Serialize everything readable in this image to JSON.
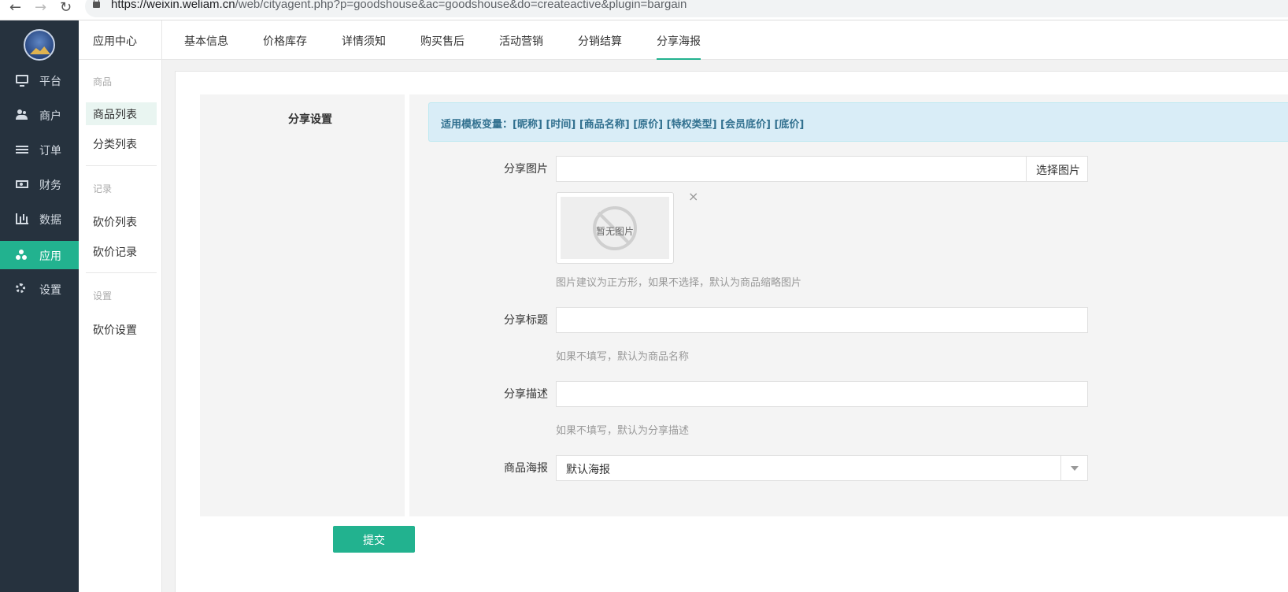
{
  "browser": {
    "url_host": "https://weixin.weliam.cn",
    "url_path": "/web/cityagent.php?p=goodshouse&ac=goodshouse&do=createactive&plugin=bargain"
  },
  "sidebar": {
    "items": [
      {
        "label": "平台",
        "icon": "monitor-icon"
      },
      {
        "label": "商户",
        "icon": "users-icon"
      },
      {
        "label": "订单",
        "icon": "list-icon"
      },
      {
        "label": "财务",
        "icon": "money-icon"
      },
      {
        "label": "数据",
        "icon": "bar-chart-icon"
      },
      {
        "label": "应用",
        "icon": "apps-icon",
        "active": true
      },
      {
        "label": "设置",
        "icon": "gear-icon"
      }
    ]
  },
  "sub_sidebar": {
    "header": "应用中心",
    "groups": [
      {
        "title": "商品",
        "items": [
          "商品列表",
          "分类列表"
        ]
      },
      {
        "title": "记录",
        "items": [
          "砍价列表",
          "砍价记录"
        ]
      },
      {
        "title": "设置",
        "items": [
          "砍价设置"
        ]
      }
    ]
  },
  "tabs": [
    "基本信息",
    "价格库存",
    "详情须知",
    "购买售后",
    "活动营销",
    "分销结算",
    "分享海报"
  ],
  "active_tab": "分享海报",
  "form": {
    "section_title": "分享设置",
    "template_vars": "适用模板变量：[昵称] [时间] [商品名称] [原价] [特权类型] [会员底价] [底价]",
    "share_image": {
      "label": "分享图片",
      "value": "",
      "button": "选择图片",
      "placeholder_text": "暂无图片",
      "remove": "×",
      "help": "图片建议为正方形，如果不选择，默认为商品缩略图片"
    },
    "share_title": {
      "label": "分享标题",
      "value": "",
      "help": "如果不填写，默认为商品名称"
    },
    "share_desc": {
      "label": "分享描述",
      "value": "",
      "help": "如果不填写，默认为分享描述"
    },
    "poster": {
      "label": "商品海报",
      "selected": "默认海报"
    },
    "submit": "提交"
  },
  "colors": {
    "accent": "#22b28f",
    "sidebar_bg": "#26323e",
    "alert_bg": "#d9edf7",
    "alert_text": "#31708f"
  }
}
